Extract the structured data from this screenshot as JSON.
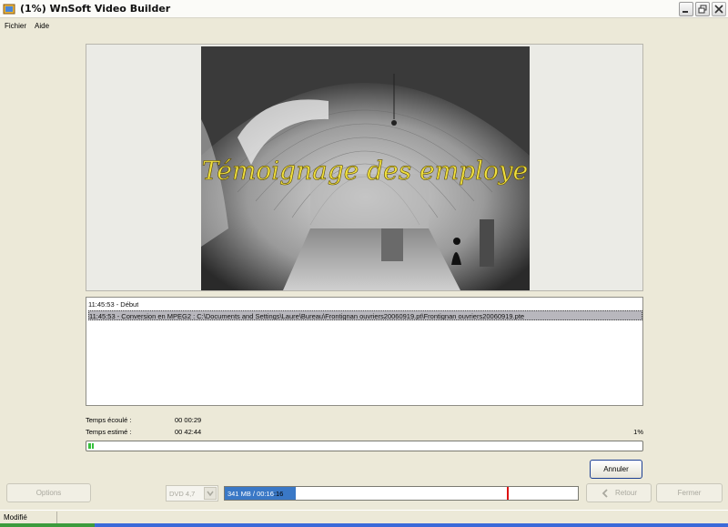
{
  "window": {
    "title": "(1%) WnSoft Video Builder"
  },
  "menu": {
    "items": [
      {
        "label": "Fichier"
      },
      {
        "label": "Aide"
      }
    ]
  },
  "preview": {
    "overlay_text": "Témoignage des employe"
  },
  "log": {
    "lines": [
      "11:45:53 - Début",
      "11:45:53 - Conversion en MPEG2 : C:\\Documents and Settings\\Laure\\Bureau\\Frontignan ouvriers20060919.pt\\Frontignan ouvriers20060919.pte"
    ],
    "selected_index": 1
  },
  "stats": {
    "elapsed_label": "Temps écoulé :",
    "elapsed_value": "00 00:29",
    "estimated_label": "Temps estimé :",
    "estimated_value": "00 42:44",
    "percent_text": "1%",
    "progress": 0.01
  },
  "buttons": {
    "cancel": "Annuler",
    "options": "Options",
    "back": "Retour",
    "close": "Fermer"
  },
  "format": {
    "selected": "DVD 4,7"
  },
  "space": {
    "used_text": "341 MB / 00:16",
    "total_duration_text": ":16",
    "used_fraction": 0.2
  },
  "status": {
    "text": "Modifié"
  }
}
